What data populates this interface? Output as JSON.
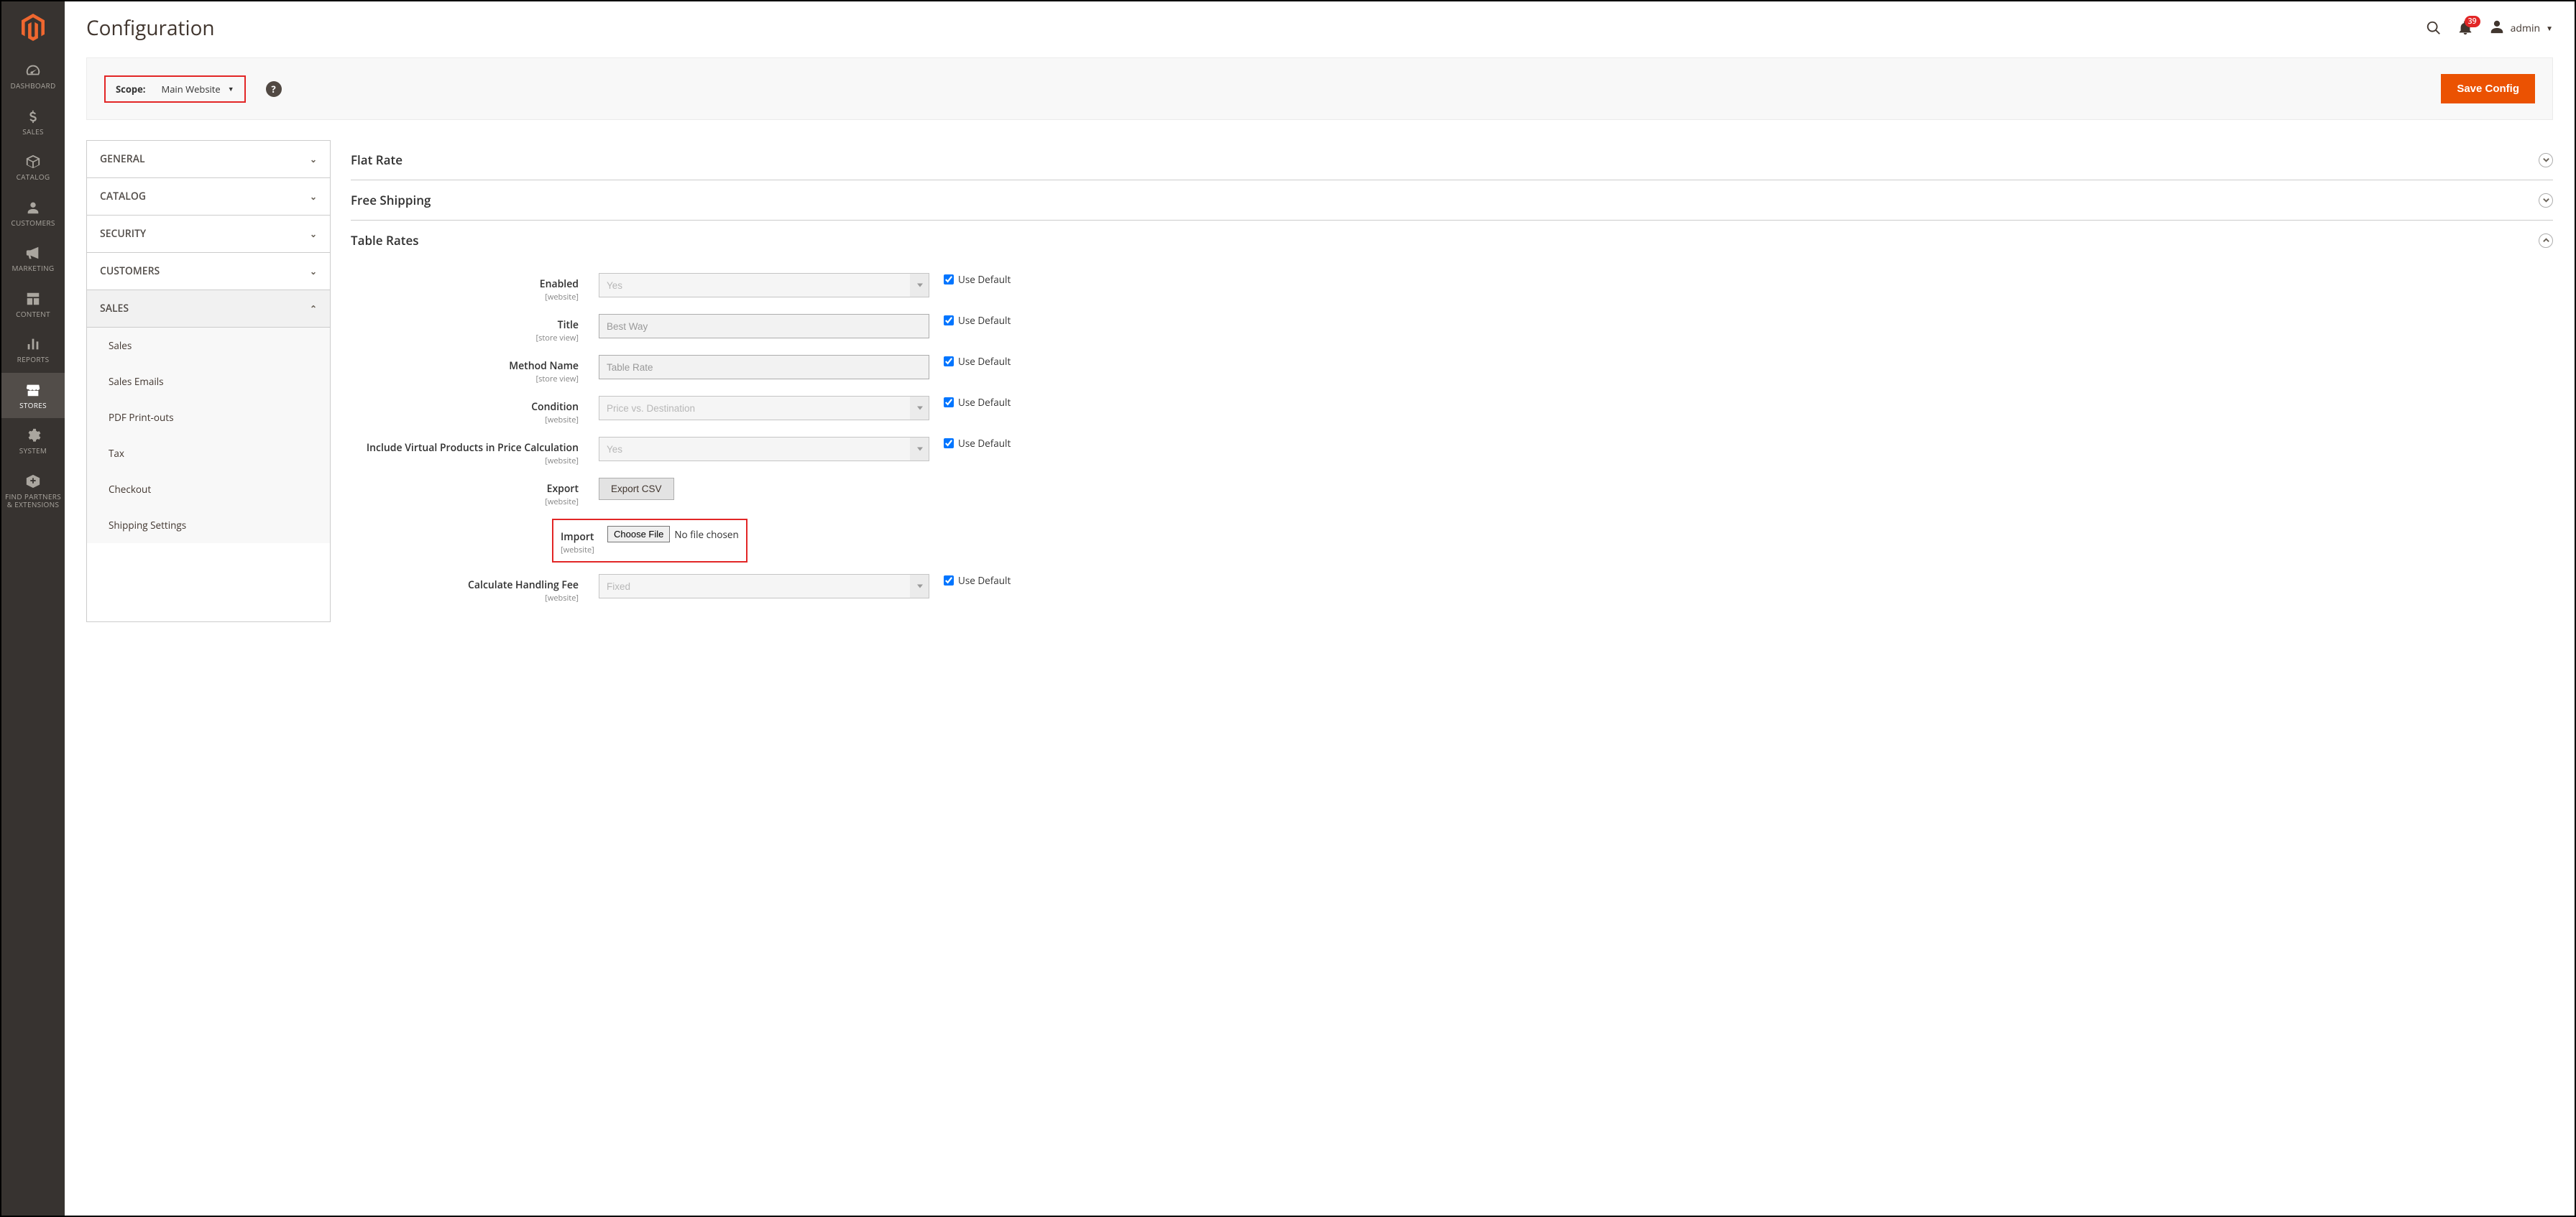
{
  "page_title": "Configuration",
  "header": {
    "notification_count": "39",
    "admin_label": "admin"
  },
  "scope": {
    "label": "Scope:",
    "value": "Main Website"
  },
  "save_button": "Save Config",
  "tabs": {
    "groups": [
      {
        "label": "GENERAL",
        "expanded": false
      },
      {
        "label": "CATALOG",
        "expanded": false
      },
      {
        "label": "SECURITY",
        "expanded": false
      },
      {
        "label": "CUSTOMERS",
        "expanded": false
      },
      {
        "label": "SALES",
        "expanded": true
      }
    ],
    "sales_sub": [
      "Sales",
      "Sales Emails",
      "PDF Print-outs",
      "Tax",
      "Checkout",
      "Shipping Settings"
    ]
  },
  "sections": {
    "flat_rate": "Flat Rate",
    "free_shipping": "Free Shipping",
    "table_rates": "Table Rates"
  },
  "fields": {
    "use_default": "Use Default",
    "enabled": {
      "label": "Enabled",
      "scope": "[website]",
      "value": "Yes"
    },
    "title": {
      "label": "Title",
      "scope": "[store view]",
      "value": "Best Way"
    },
    "method_name": {
      "label": "Method Name",
      "scope": "[store view]",
      "value": "Table Rate"
    },
    "condition": {
      "label": "Condition",
      "scope": "[website]",
      "value": "Price vs. Destination"
    },
    "virtual": {
      "label": "Include Virtual Products in Price Calculation",
      "scope": "[website]",
      "value": "Yes"
    },
    "export": {
      "label": "Export",
      "scope": "[website]",
      "button": "Export CSV"
    },
    "import": {
      "label": "Import",
      "scope": "[website]",
      "button": "Choose File",
      "placeholder": "No file chosen"
    },
    "handling": {
      "label": "Calculate Handling Fee",
      "scope": "[website]",
      "value": "Fixed"
    }
  },
  "nav": [
    {
      "label": "DASHBOARD"
    },
    {
      "label": "SALES"
    },
    {
      "label": "CATALOG"
    },
    {
      "label": "CUSTOMERS"
    },
    {
      "label": "MARKETING"
    },
    {
      "label": "CONTENT"
    },
    {
      "label": "REPORTS"
    },
    {
      "label": "STORES"
    },
    {
      "label": "SYSTEM"
    },
    {
      "label": "FIND PARTNERS & EXTENSIONS"
    }
  ]
}
